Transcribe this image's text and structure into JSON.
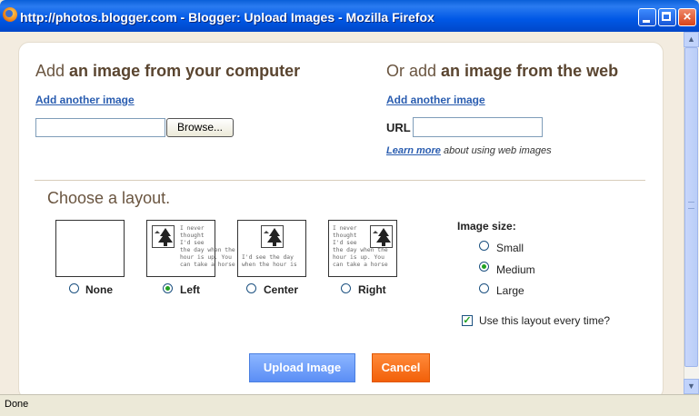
{
  "window": {
    "title": "http://photos.blogger.com - Blogger: Upload Images - Mozilla Firefox",
    "close_glyph": "×"
  },
  "left_panel": {
    "heading_plain": "Add",
    "heading_bold": "an image from your computer",
    "add_another": "Add another image",
    "browse_label": "Browse..."
  },
  "right_panel": {
    "heading_plain": "Or add",
    "heading_bold": "an image from the web",
    "add_another": "Add another image",
    "url_label": "URL",
    "learn_more": "Learn more",
    "learn_more_suffix": "about using web images"
  },
  "layout": {
    "heading": "Choose a layout.",
    "sample_text": "I never\nthought\nI'd see\nthe day when the\nhour is up. You\ncan take a horse",
    "options": [
      {
        "label": "None",
        "selected": false
      },
      {
        "label": "Left",
        "selected": true
      },
      {
        "label": "Center",
        "selected": false
      },
      {
        "label": "Right",
        "selected": false
      }
    ]
  },
  "image_size": {
    "title": "Image size:",
    "options": [
      {
        "label": "Small",
        "selected": false
      },
      {
        "label": "Medium",
        "selected": true
      },
      {
        "label": "Large",
        "selected": false
      }
    ],
    "remember_label": "Use this layout every time?",
    "remember_checked": true
  },
  "actions": {
    "upload": "Upload Image",
    "cancel": "Cancel"
  },
  "status": {
    "text": "Done"
  },
  "colors": {
    "selected_radio": "#21a121",
    "upload_button": "#6d9cf8",
    "cancel_button": "#f26009",
    "link": "#2a5db0"
  }
}
